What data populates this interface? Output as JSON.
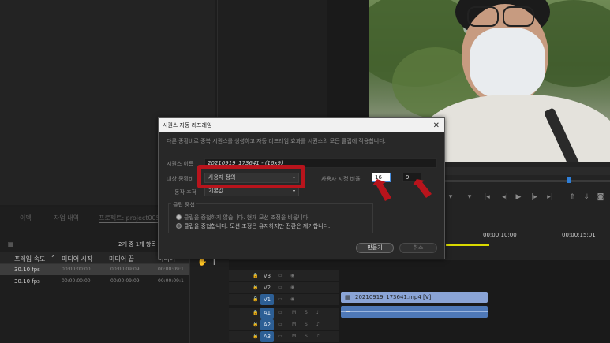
{
  "project": {
    "tabs": [
      "이펙",
      "자업 내역",
      "프로젝트: project005"
    ],
    "count": "2개 중 1개 항목",
    "columns": [
      "프레임 속도",
      "미디어 시작",
      "미디어 끝",
      "미디어"
    ],
    "rows": [
      {
        "fps": "30.10 fps",
        "start": "00:00:00:00",
        "end": "00:00:09:09",
        "dur": "00:00:09:1"
      },
      {
        "fps": "30.10 fps",
        "start": "00:00:00:00",
        "end": "00:00:09:09",
        "dur": "00:00:09:1"
      }
    ]
  },
  "timeline": {
    "time_1": "00:00:10:00",
    "time_2": "00:00:15:01",
    "tracks": [
      "V3",
      "V2",
      "V1",
      "A1",
      "A2",
      "A3"
    ],
    "clip_label": "20210919_173641.mp4 [V]"
  },
  "dialog": {
    "title": "시퀀스 자동 리프레임",
    "description": "다른 종횡비로 중복 시퀀스를 생성하고 자동 리프레임 효과를 시퀀스의 모든 클립에 적용합니다.",
    "seq_name_label": "시퀀스 이름",
    "seq_name_value": "20210919_173641 - (16x9)",
    "aspect_label": "대상 종횡비",
    "aspect_value": "사용자 정의",
    "custom_ratio_label": "사용자 지정 비율",
    "ratio_w": "16",
    "ratio_h": "9",
    "motion_label": "동작 추적",
    "motion_value": "기본값",
    "clip_nest_label": "클립 중첩",
    "option_1": "클립을 중첩하지 않습니다. 현재 모션 조정을 비웁니다.",
    "option_2": "클립을 중첩합니다. 모션 조정은 유지하지만 전환은 제거합니다.",
    "create_button": "만들기",
    "cancel_button": "취소"
  },
  "colors": {
    "highlight": "#b8141c",
    "accent": "#2f7fd8"
  }
}
